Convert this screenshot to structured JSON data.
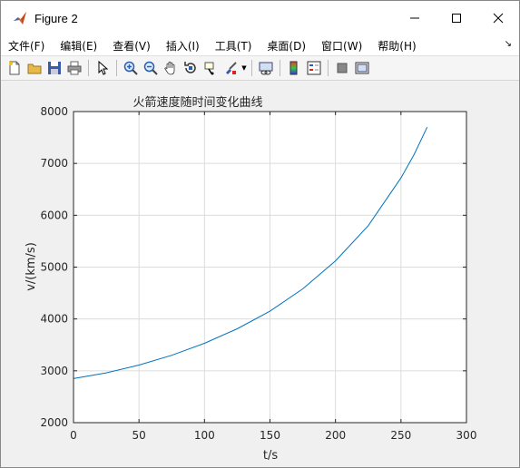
{
  "window": {
    "title": "Figure 2",
    "icon": "matlab-logo-icon"
  },
  "menu": {
    "items": [
      {
        "label": "文件(F)"
      },
      {
        "label": "编辑(E)"
      },
      {
        "label": "查看(V)"
      },
      {
        "label": "插入(I)"
      },
      {
        "label": "工具(T)"
      },
      {
        "label": "桌面(D)"
      },
      {
        "label": "窗口(W)"
      },
      {
        "label": "帮助(H)"
      }
    ]
  },
  "toolbar": {
    "icons": [
      "new-figure-icon",
      "open-file-icon",
      "save-icon",
      "print-icon",
      "select-arrow-icon",
      "zoom-in-icon",
      "zoom-out-icon",
      "pan-icon",
      "rotate-3d-icon",
      "data-cursor-icon",
      "brush-icon",
      "link-plot-icon",
      "colorbar-icon",
      "legend-icon",
      "hide-plot-tools-icon",
      "show-plot-tools-icon"
    ]
  },
  "colors": {
    "line": "#0072BD",
    "grid": "#dcdcdc",
    "axes_bg": "#ffffff",
    "figure_bg": "#f0f0f0"
  },
  "chart_data": {
    "type": "line",
    "title": "火箭速度随时间变化曲线",
    "xlabel": "t/s",
    "ylabel": "v/(km/s)",
    "xlim": [
      0,
      300
    ],
    "ylim": [
      2000,
      8000
    ],
    "xticks": [
      0,
      50,
      100,
      150,
      200,
      250,
      300
    ],
    "yticks": [
      2000,
      3000,
      4000,
      5000,
      6000,
      7000,
      8000
    ],
    "grid": true,
    "series": [
      {
        "x": [
          0,
          25,
          50,
          75,
          100,
          125,
          150,
          175,
          200,
          225,
          250,
          260,
          270
        ],
        "y": [
          2850,
          2960,
          3110,
          3300,
          3530,
          3810,
          4150,
          4580,
          5120,
          5800,
          6720,
          7170,
          7700
        ]
      }
    ]
  }
}
